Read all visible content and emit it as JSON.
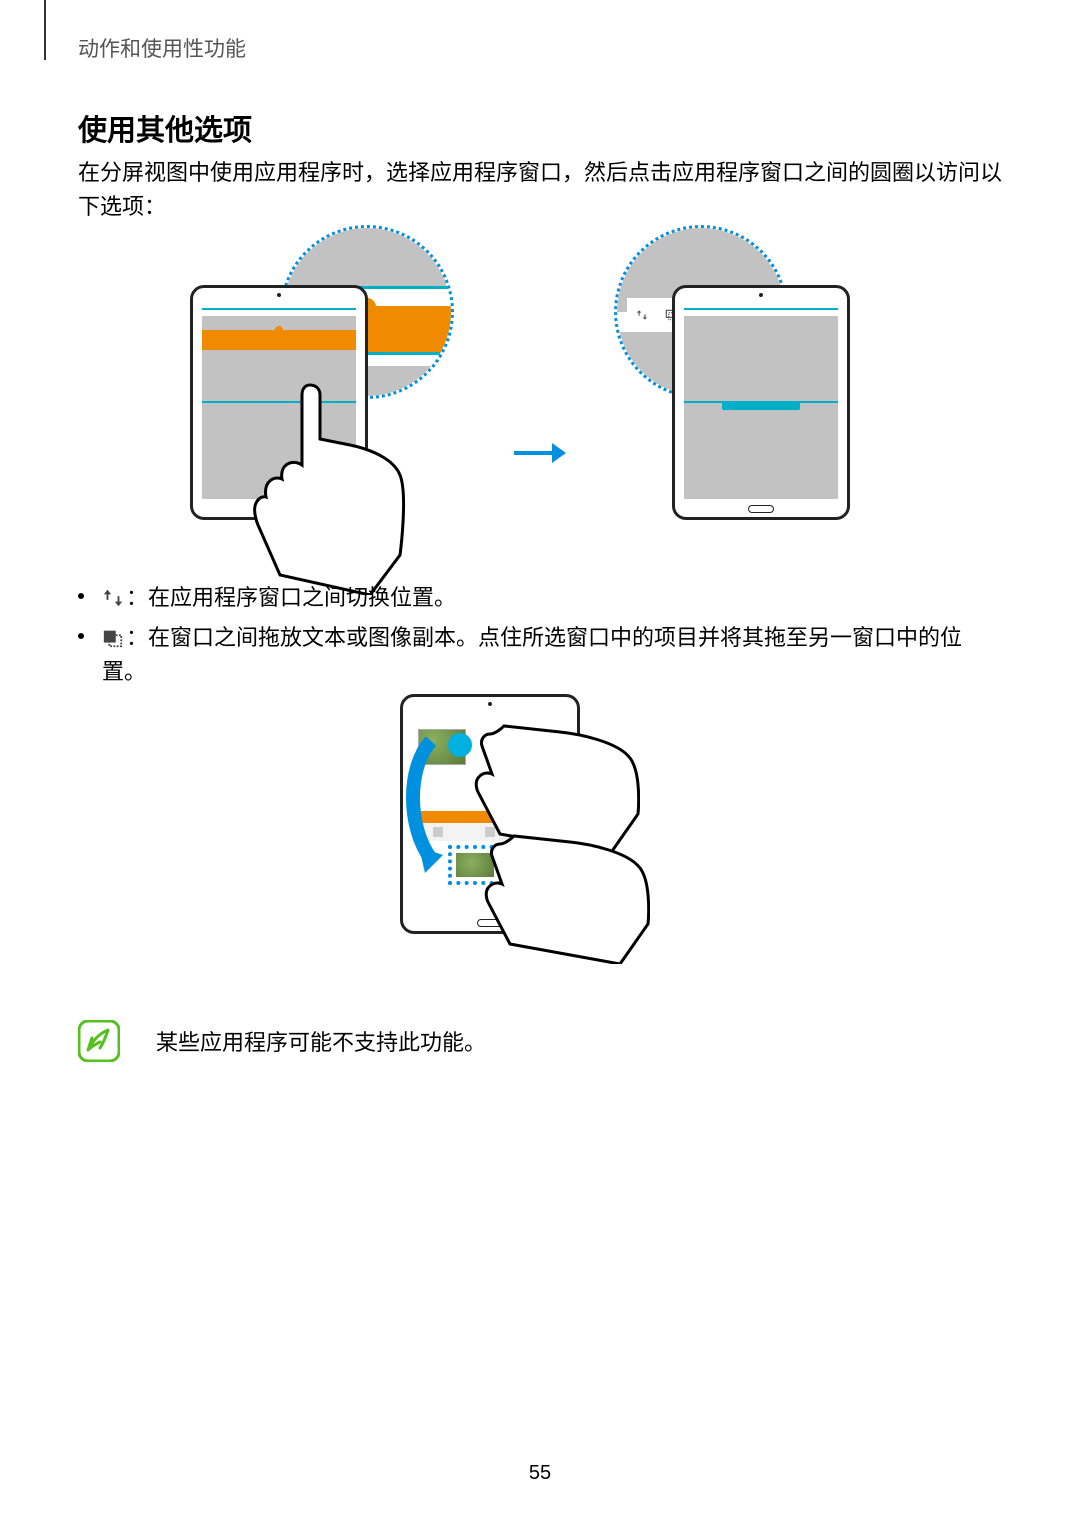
{
  "breadcrumb": "动作和使用性功能",
  "section_title": "使用其他选项",
  "section_body": "在分屏视图中使用应用程序时，选择应用程序窗口，然后点击应用程序窗口之间的圆圈以访问以下选项：",
  "bullets": [
    {
      "icon": "swap-icon",
      "text": "：在应用程序窗口之间切换位置。"
    },
    {
      "icon": "drag-content-icon",
      "text": "：在窗口之间拖放文本或图像副本。点住所选窗口中的项目并将其拖至另一窗口中的位置。"
    }
  ],
  "note": "某些应用程序可能不支持此功能。",
  "page_number": "55"
}
